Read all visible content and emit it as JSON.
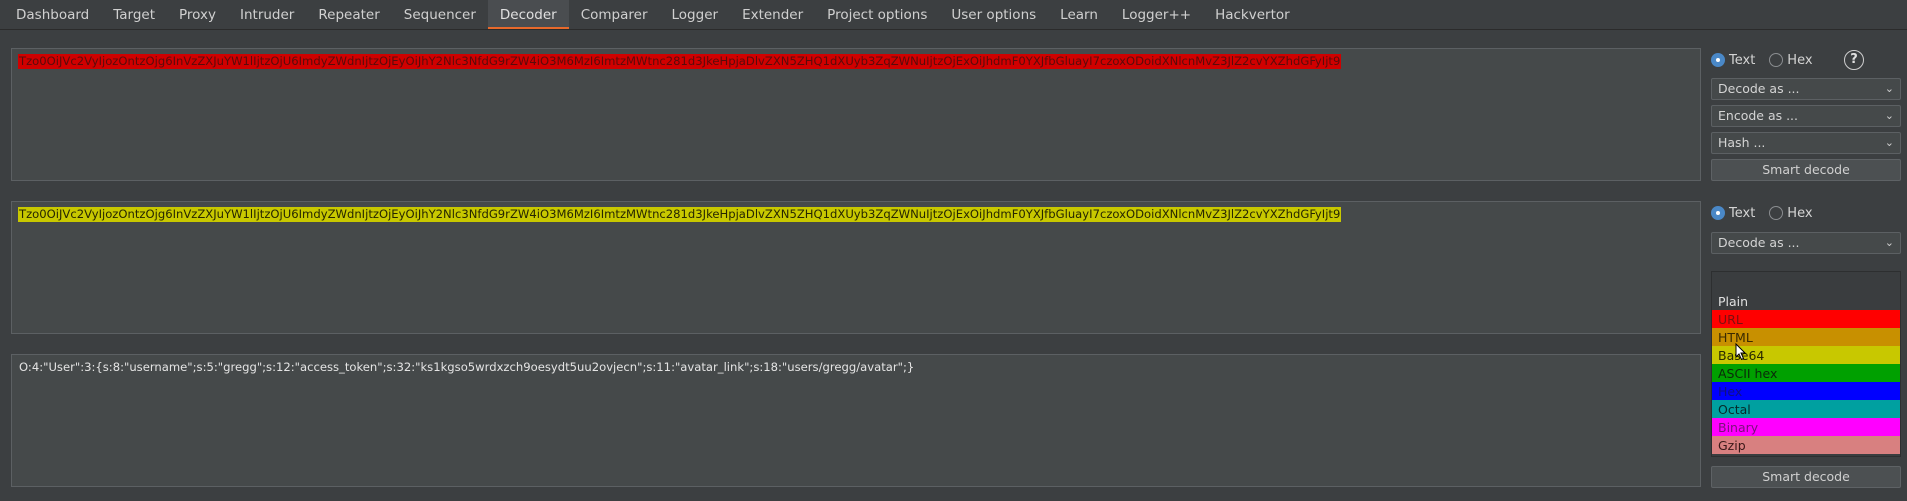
{
  "tabs": [
    {
      "label": "Dashboard",
      "name": "tab-dashboard",
      "active": false
    },
    {
      "label": "Target",
      "name": "tab-target",
      "active": false
    },
    {
      "label": "Proxy",
      "name": "tab-proxy",
      "active": false
    },
    {
      "label": "Intruder",
      "name": "tab-intruder",
      "active": false
    },
    {
      "label": "Repeater",
      "name": "tab-repeater",
      "active": false
    },
    {
      "label": "Sequencer",
      "name": "tab-sequencer",
      "active": false
    },
    {
      "label": "Decoder",
      "name": "tab-decoder",
      "active": true
    },
    {
      "label": "Comparer",
      "name": "tab-comparer",
      "active": false
    },
    {
      "label": "Logger",
      "name": "tab-logger",
      "active": false
    },
    {
      "label": "Extender",
      "name": "tab-extender",
      "active": false
    },
    {
      "label": "Project options",
      "name": "tab-project-options",
      "active": false
    },
    {
      "label": "User options",
      "name": "tab-user-options",
      "active": false
    },
    {
      "label": "Learn",
      "name": "tab-learn",
      "active": false
    },
    {
      "label": "Logger++",
      "name": "tab-logger-plus-plus",
      "active": false
    },
    {
      "label": "Hackvertor",
      "name": "tab-hackvertor",
      "active": false
    }
  ],
  "pane1": {
    "text": "Tzo0OiJVc2VyIjozOntzOjg6InVzZXJuYW1lIjtzOjU6ImdyZWdnIjtzOjEyOiJhY2Nlc3NfdG9rZW4iO3M6MzI6ImtzMWtnc281d3JkeHpjaDlvZXN5ZHQ1dXUyb3ZqZWNuIjtzOjExOiJhdmF0YXJfbGluayI7czoxODoidXNlcnMvZ3JlZ2cvYXZhdGFyIjt9",
    "highlight": "#d00000"
  },
  "pane2": {
    "text": "Tzo0OiJVc2VyIjozOntzOjg6InVzZXJuYW1lIjtzOjU6ImdyZWdnIjtzOjEyOiJhY2Nlc3NfdG9rZW4iO3M6MzI6ImtzMWtnc281d3JkeHpjaDlvZXN5ZHQ1dXUyb3ZqZWNuIjtzOjExOiJhdmF0YXJfbGluayI7czoxODoidXNlcnMvZ3JlZ2cvYXZhdGFyIjt9",
    "highlight": "#c8c800"
  },
  "pane3": {
    "text": "O:4:\"User\":3:{s:8:\"username\";s:5:\"gregg\";s:12:\"access_token\";s:32:\"ks1kgso5wrdxzch9oesydt5uu2ovjecn\";s:11:\"avatar_link\";s:18:\"users/gregg/avatar\";}"
  },
  "controls1": {
    "radio_text": "Text",
    "radio_hex": "Hex",
    "selected": "Text",
    "help_icon": "?",
    "decode_select": "Decode as ...",
    "encode_select": "Encode as ...",
    "hash_select": "Hash ...",
    "smart_decode": "Smart decode"
  },
  "controls2": {
    "radio_text": "Text",
    "radio_hex": "Hex",
    "selected": "Text",
    "decode_select": "Decode as ...",
    "smart_decode": "Smart decode"
  },
  "dropdown": {
    "items": [
      {
        "label": "Plain",
        "bg": "#3a3d3f",
        "fg": "#e0e0e0"
      },
      {
        "label": "URL",
        "bg": "#ff0000",
        "fg": "#7a1010"
      },
      {
        "label": "HTML",
        "bg": "#c89000",
        "fg": "#3a2a00"
      },
      {
        "label": "Base64",
        "bg": "#c8c800",
        "fg": "#2a2a00"
      },
      {
        "label": "ASCII hex",
        "bg": "#00a000",
        "fg": "#0a2a0a"
      },
      {
        "label": "Hex",
        "bg": "#0000ff",
        "fg": "#101080"
      },
      {
        "label": "Octal",
        "bg": "#00a0a0",
        "fg": "#062a2a"
      },
      {
        "label": "Binary",
        "bg": "#ff00ff",
        "fg": "#7a107a"
      },
      {
        "label": "Gzip",
        "bg": "#d88080",
        "fg": "#3a1818"
      }
    ]
  }
}
